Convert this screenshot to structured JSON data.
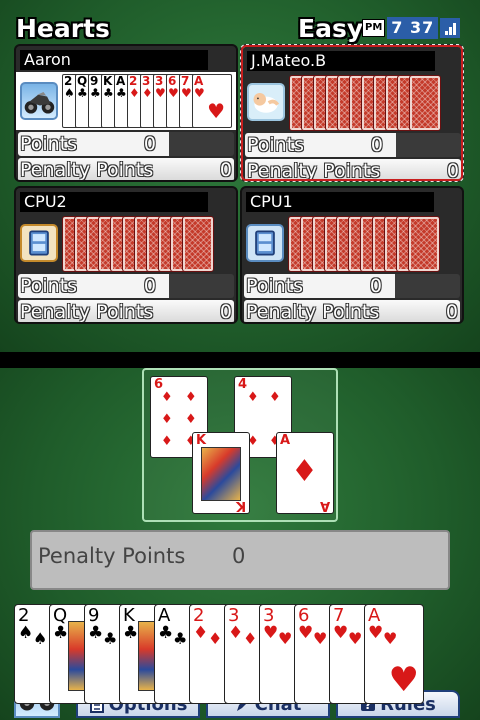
{
  "header": {
    "game_title": "Hearts",
    "difficulty": "Easy",
    "time_period": "PM",
    "time": "7 37"
  },
  "players": [
    {
      "name": "Aaron",
      "avatar": "motorcycle-icon",
      "points_label": "Points",
      "points": "0",
      "penalty_label": "Penalty Points",
      "penalty": "0",
      "visible_cards": [
        {
          "rank": "2",
          "suit": "♠",
          "color": "black"
        },
        {
          "rank": "Q",
          "suit": "♣",
          "color": "black"
        },
        {
          "rank": "9",
          "suit": "♣",
          "color": "black"
        },
        {
          "rank": "K",
          "suit": "♣",
          "color": "black"
        },
        {
          "rank": "A",
          "suit": "♣",
          "color": "black"
        },
        {
          "rank": "2",
          "suit": "♦",
          "color": "red"
        },
        {
          "rank": "3",
          "suit": "♦",
          "color": "red"
        },
        {
          "rank": "3",
          "suit": "♥",
          "color": "red"
        },
        {
          "rank": "6",
          "suit": "♥",
          "color": "red"
        },
        {
          "rank": "7",
          "suit": "♥",
          "color": "red"
        },
        {
          "rank": "A",
          "suit": "♥",
          "color": "red"
        }
      ]
    },
    {
      "name": "J.Mateo.B",
      "avatar": "baby-icon",
      "points_label": "Points",
      "points": "0",
      "penalty_label": "Penalty Points",
      "penalty": "0",
      "active": true
    },
    {
      "name": "CPU2",
      "avatar": "ds-console-icon",
      "points_label": "Points",
      "points": "0",
      "penalty_label": "Penalty Points",
      "penalty": "0"
    },
    {
      "name": "CPU1",
      "avatar": "ds-console-icon",
      "points_label": "Points",
      "points": "0",
      "penalty_label": "Penalty Points",
      "penalty": "0"
    }
  ],
  "trick": [
    {
      "rank": "6",
      "suit": "♦",
      "color": "red"
    },
    {
      "rank": "4",
      "suit": "♦",
      "color": "red"
    },
    {
      "rank": "K",
      "suit": "♦",
      "color": "red"
    },
    {
      "rank": "A",
      "suit": "♦",
      "color": "red"
    }
  ],
  "status": {
    "penalty_label": "Penalty Points",
    "penalty_value": "0"
  },
  "hand": [
    {
      "rank": "2",
      "suit": "♠",
      "color": "black"
    },
    {
      "rank": "Q",
      "suit": "♣",
      "color": "black"
    },
    {
      "rank": "9",
      "suit": "♣",
      "color": "black"
    },
    {
      "rank": "K",
      "suit": "♣",
      "color": "black"
    },
    {
      "rank": "A",
      "suit": "♣",
      "color": "black"
    },
    {
      "rank": "2",
      "suit": "♦",
      "color": "red"
    },
    {
      "rank": "3",
      "suit": "♦",
      "color": "red"
    },
    {
      "rank": "3",
      "suit": "♥",
      "color": "red"
    },
    {
      "rank": "6",
      "suit": "♥",
      "color": "red"
    },
    {
      "rank": "7",
      "suit": "♥",
      "color": "red"
    },
    {
      "rank": "A",
      "suit": "♥",
      "color": "red"
    }
  ],
  "toolbar": {
    "options_label": "Options",
    "chat_label": "Chat",
    "rules_label": "Rules"
  },
  "colors": {
    "table_green": "#1f5c2a",
    "card_back_red": "#c43a2a",
    "heart_red": "#d81818",
    "button_blue": "#1a2f63",
    "active_outline": "#c81e1e"
  }
}
